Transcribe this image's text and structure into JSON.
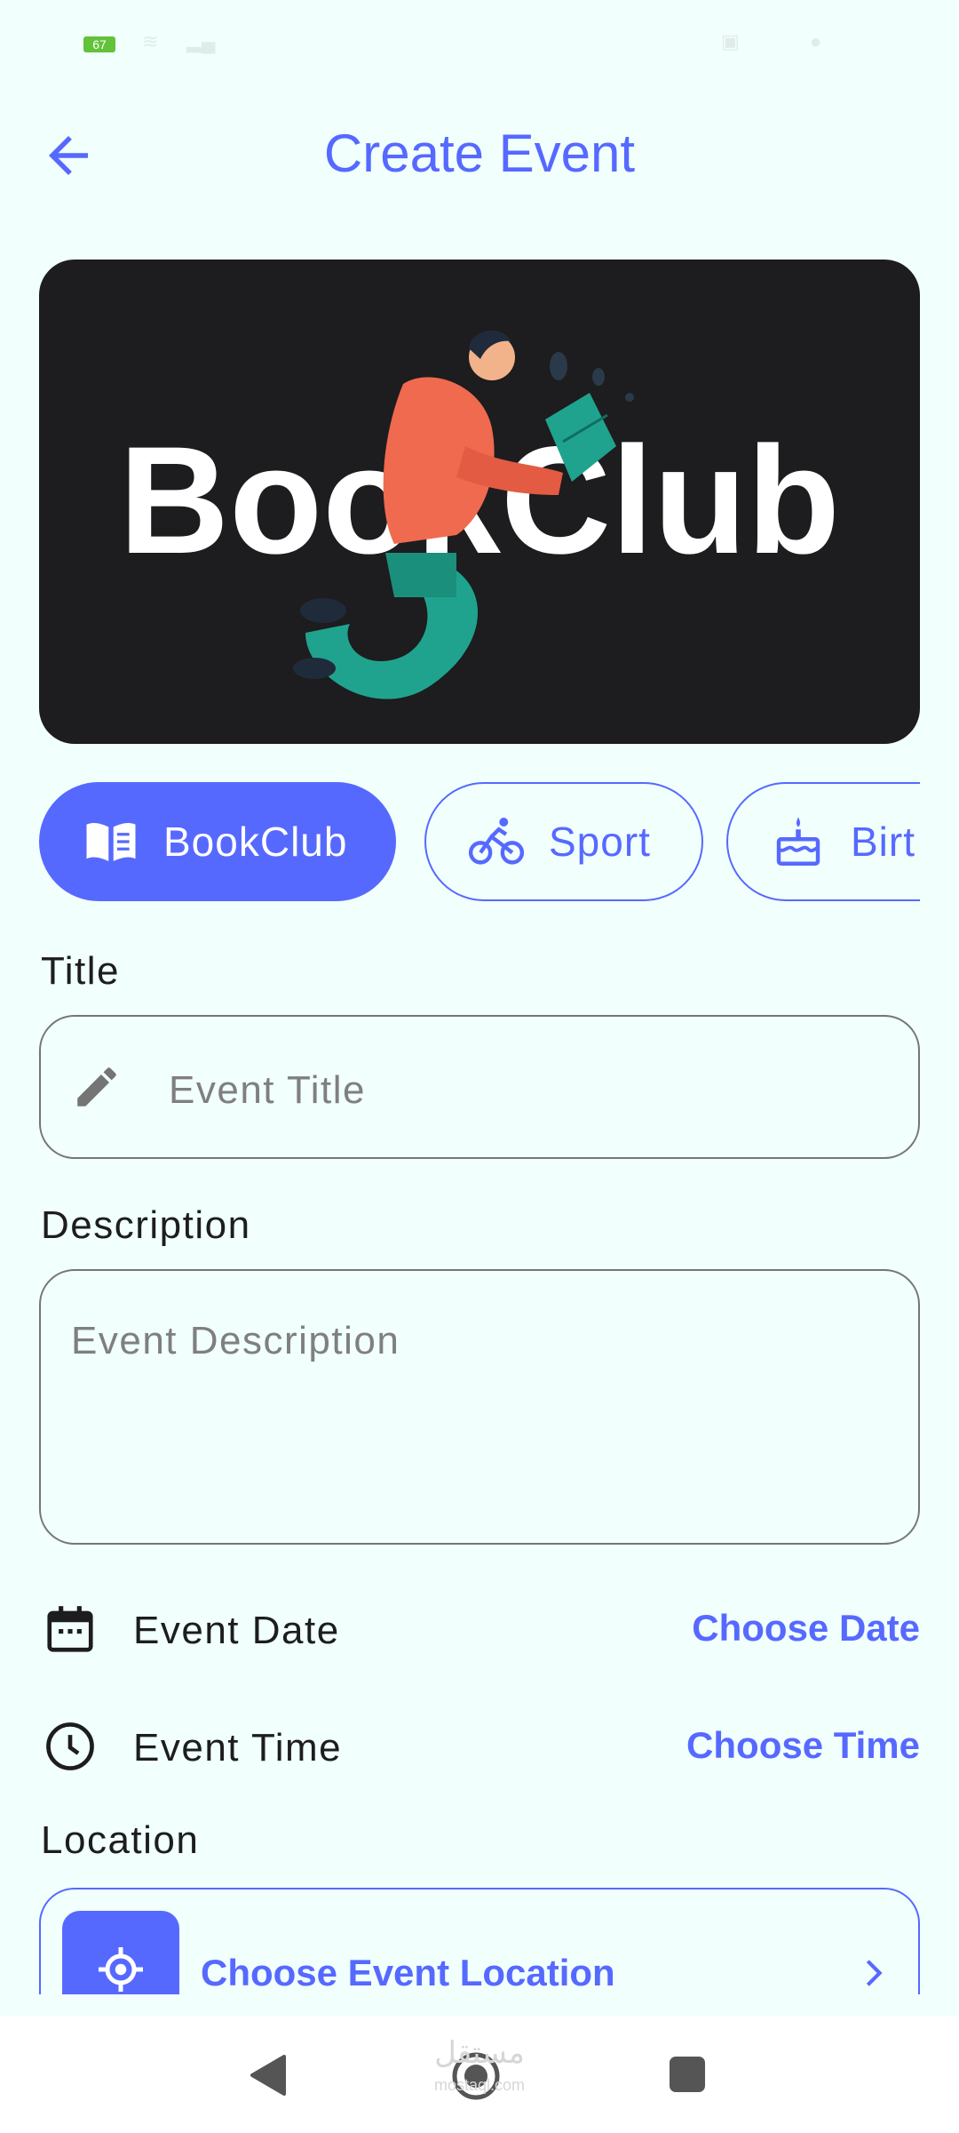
{
  "status_bar": {
    "battery_level": "67"
  },
  "app_bar": {
    "title": "Create Event",
    "back_icon": "arrow-back-icon"
  },
  "hero": {
    "image_text": "BookClub",
    "colors": {
      "background": "#1d1c1e",
      "text": "#ffffff",
      "shirt": "#ef6a4f",
      "pants": "#1fa38e"
    }
  },
  "categories": [
    {
      "label": "BookClub",
      "icon": "book-icon",
      "selected": true
    },
    {
      "label": "Sport",
      "icon": "bike-icon",
      "selected": false
    },
    {
      "label": "Birt",
      "icon": "cake-icon",
      "selected": false
    }
  ],
  "form": {
    "title_label": "Title",
    "title_placeholder": "Event Title",
    "title_value": "",
    "description_label": "Description",
    "description_placeholder": "Event Description",
    "description_value": "",
    "date_label": "Event Date",
    "date_action": "Choose Date",
    "time_label": "Event Time",
    "time_action": "Choose Time",
    "location_label": "Location",
    "location_action": "Choose Event Location"
  },
  "nav_bar": {
    "buttons": [
      "back-triangle-icon",
      "home-circle-icon",
      "recents-square-icon"
    ],
    "watermark": "مستقل",
    "watermark_sub": "mostaql.com"
  },
  "colors": {
    "accent": "#5669ff",
    "background": "#f1fffd",
    "text": "#1d1d1d",
    "placeholder": "#7f7f7f",
    "border": "#757575"
  }
}
